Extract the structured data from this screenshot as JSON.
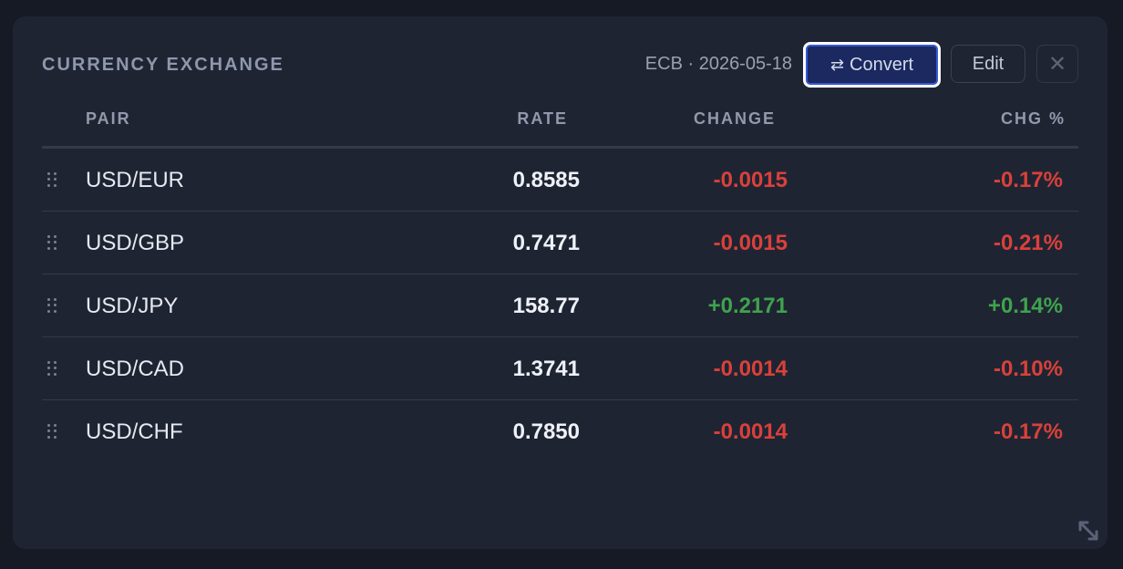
{
  "widget": {
    "title": "CURRENCY EXCHANGE",
    "source": "ECB · 2026-05-18",
    "convert_icon": "⇄",
    "convert_label": "Convert",
    "edit_label": "Edit",
    "close_icon": "✕"
  },
  "table": {
    "headers": {
      "pair": "PAIR",
      "rate": "RATE",
      "change": "CHANGE",
      "chg_pct": "CHG %"
    },
    "rows": [
      {
        "pair": "USD/EUR",
        "rate": "0.8585",
        "change": "-0.0015",
        "chg_pct": "-0.17%",
        "direction": "down"
      },
      {
        "pair": "USD/GBP",
        "rate": "0.7471",
        "change": "-0.0015",
        "chg_pct": "-0.21%",
        "direction": "down"
      },
      {
        "pair": "USD/JPY",
        "rate": "158.77",
        "change": "+0.2171",
        "chg_pct": "+0.14%",
        "direction": "up"
      },
      {
        "pair": "USD/CAD",
        "rate": "1.3741",
        "change": "-0.0014",
        "chg_pct": "-0.10%",
        "direction": "down"
      },
      {
        "pair": "USD/CHF",
        "rate": "0.7850",
        "change": "-0.0014",
        "chg_pct": "-0.17%",
        "direction": "down"
      }
    ]
  },
  "colors": {
    "positive": "#3fa34d",
    "negative": "#d9413a",
    "accent": "#3658d4"
  }
}
